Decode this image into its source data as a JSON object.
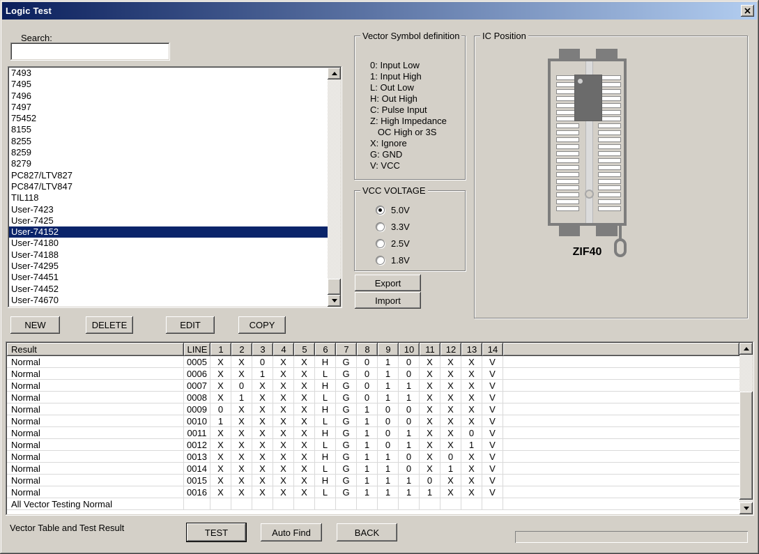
{
  "window": {
    "title": "Logic Test"
  },
  "search": {
    "label": "Search:",
    "value": "",
    "placeholder": ""
  },
  "ic_list": {
    "items": [
      "7493",
      "7495",
      "7496",
      "7497",
      "75452",
      "8155",
      "8255",
      "8259",
      "8279",
      "PC827/LTV827",
      "PC847/LTV847",
      "TIL118",
      "User-7423",
      "User-7425",
      "User-74152",
      "User-74180",
      "User-74188",
      "User-74295",
      "User-74451",
      "User-74452",
      "User-74670"
    ],
    "selected_index": 14,
    "selected_value": "User-74152"
  },
  "list_buttons": {
    "new": "NEW",
    "delete": "DELETE",
    "edit": "EDIT",
    "copy": "COPY"
  },
  "vector_symbols": {
    "title": "Vector Symbol definition",
    "lines": [
      "0: Input Low",
      "1: Input High",
      "L: Out Low",
      "H: Out High",
      "C: Pulse Input",
      "Z: High Impedance",
      "   OC High or 3S",
      "X: Ignore",
      "G: GND",
      "V: VCC"
    ]
  },
  "vcc_voltage": {
    "title": "VCC VOLTAGE",
    "options": [
      {
        "label": "5.0V",
        "selected": true
      },
      {
        "label": "3.3V",
        "selected": false
      },
      {
        "label": "2.5V",
        "selected": false
      },
      {
        "label": "1.8V",
        "selected": false
      }
    ]
  },
  "io_buttons": {
    "export": "Export",
    "import": "Import"
  },
  "ic_position": {
    "title": "IC Position",
    "socket_label": "ZIF40",
    "pins_per_side": 20,
    "chip_pins_covered": 7
  },
  "result_table": {
    "columns": [
      "Result",
      "LINE",
      "1",
      "2",
      "3",
      "4",
      "5",
      "6",
      "7",
      "8",
      "9",
      "10",
      "11",
      "12",
      "13",
      "14"
    ],
    "rows": [
      {
        "result": "Normal",
        "line": "0005",
        "pins": [
          "X",
          "X",
          "0",
          "X",
          "X",
          "H",
          "G",
          "0",
          "1",
          "0",
          "X",
          "X",
          "X",
          "V"
        ]
      },
      {
        "result": "Normal",
        "line": "0006",
        "pins": [
          "X",
          "X",
          "1",
          "X",
          "X",
          "L",
          "G",
          "0",
          "1",
          "0",
          "X",
          "X",
          "X",
          "V"
        ]
      },
      {
        "result": "Normal",
        "line": "0007",
        "pins": [
          "X",
          "0",
          "X",
          "X",
          "X",
          "H",
          "G",
          "0",
          "1",
          "1",
          "X",
          "X",
          "X",
          "V"
        ]
      },
      {
        "result": "Normal",
        "line": "0008",
        "pins": [
          "X",
          "1",
          "X",
          "X",
          "X",
          "L",
          "G",
          "0",
          "1",
          "1",
          "X",
          "X",
          "X",
          "V"
        ]
      },
      {
        "result": "Normal",
        "line": "0009",
        "pins": [
          "0",
          "X",
          "X",
          "X",
          "X",
          "H",
          "G",
          "1",
          "0",
          "0",
          "X",
          "X",
          "X",
          "V"
        ]
      },
      {
        "result": "Normal",
        "line": "0010",
        "pins": [
          "1",
          "X",
          "X",
          "X",
          "X",
          "L",
          "G",
          "1",
          "0",
          "0",
          "X",
          "X",
          "X",
          "V"
        ]
      },
      {
        "result": "Normal",
        "line": "0011",
        "pins": [
          "X",
          "X",
          "X",
          "X",
          "X",
          "H",
          "G",
          "1",
          "0",
          "1",
          "X",
          "X",
          "0",
          "V"
        ]
      },
      {
        "result": "Normal",
        "line": "0012",
        "pins": [
          "X",
          "X",
          "X",
          "X",
          "X",
          "L",
          "G",
          "1",
          "0",
          "1",
          "X",
          "X",
          "1",
          "V"
        ]
      },
      {
        "result": "Normal",
        "line": "0013",
        "pins": [
          "X",
          "X",
          "X",
          "X",
          "X",
          "H",
          "G",
          "1",
          "1",
          "0",
          "X",
          "0",
          "X",
          "V"
        ]
      },
      {
        "result": "Normal",
        "line": "0014",
        "pins": [
          "X",
          "X",
          "X",
          "X",
          "X",
          "L",
          "G",
          "1",
          "1",
          "0",
          "X",
          "1",
          "X",
          "V"
        ]
      },
      {
        "result": "Normal",
        "line": "0015",
        "pins": [
          "X",
          "X",
          "X",
          "X",
          "X",
          "H",
          "G",
          "1",
          "1",
          "1",
          "0",
          "X",
          "X",
          "V"
        ]
      },
      {
        "result": "Normal",
        "line": "0016",
        "pins": [
          "X",
          "X",
          "X",
          "X",
          "X",
          "L",
          "G",
          "1",
          "1",
          "1",
          "1",
          "X",
          "X",
          "V"
        ]
      }
    ],
    "footer": "All Vector Testing Normal"
  },
  "bottom": {
    "label": "Vector Table and Test Result",
    "test": "TEST",
    "auto_find": "Auto Find",
    "back": "BACK"
  },
  "colors": {
    "background": "#d4d0c8",
    "titlebar_start": "#0a1f5c",
    "titlebar_end": "#b2cdf0",
    "selection": "#0a246a",
    "socket_gray": "#7d7d7d"
  }
}
